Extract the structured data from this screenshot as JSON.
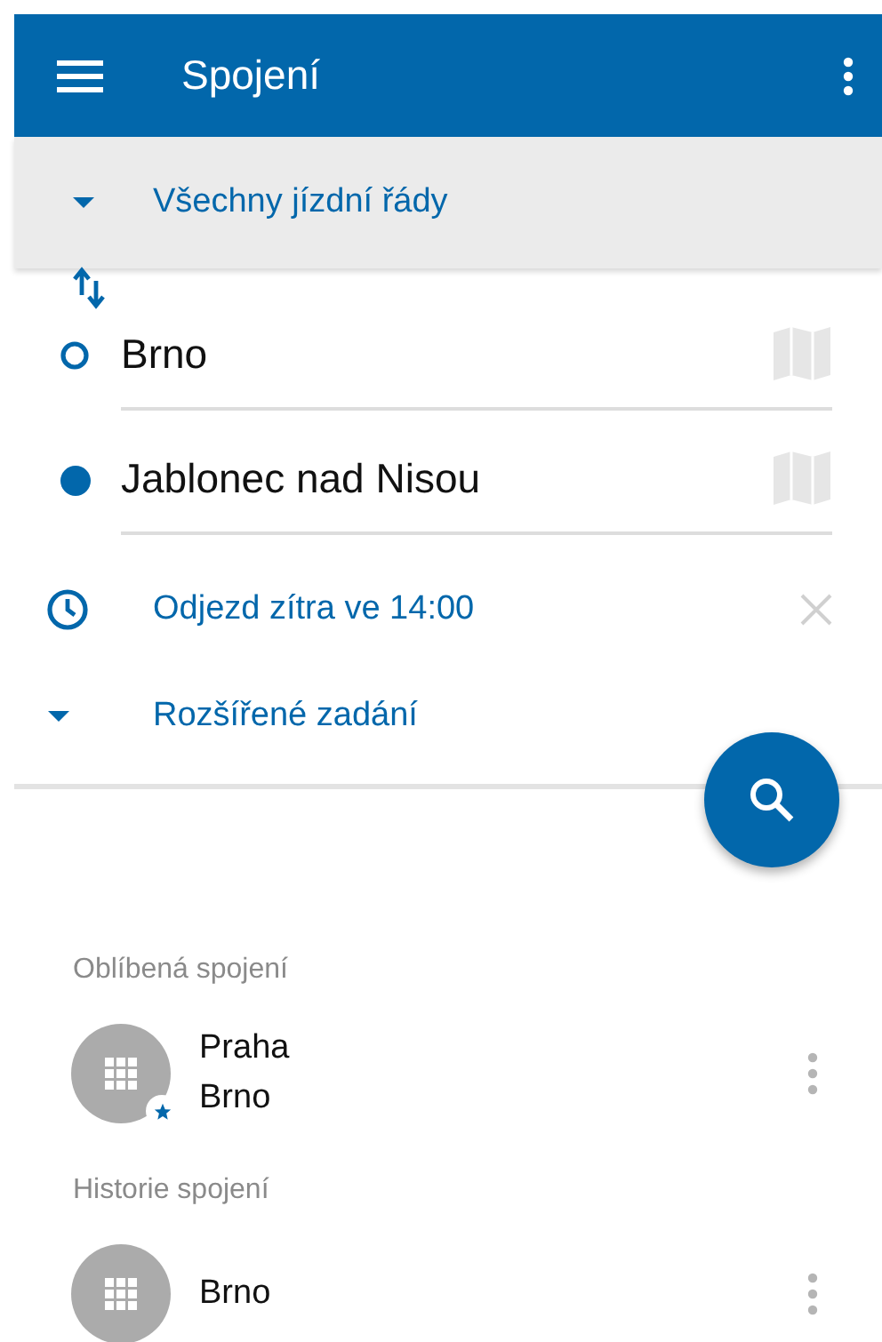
{
  "app_bar": {
    "title": "Spojení"
  },
  "filter": {
    "label": "Všechny jízdní řády",
    "expanded": false
  },
  "route": {
    "from": "Brno",
    "to": "Jablonec nad Nisou"
  },
  "departure": {
    "label": "Odjezd zítra ve 14:00"
  },
  "advanced": {
    "label": "Rozšířené zadání",
    "expanded": false
  },
  "sections": [
    {
      "title": "Oblíbená spojení",
      "items": [
        {
          "lines": [
            "Praha",
            "Brno"
          ],
          "favorite": true
        }
      ]
    },
    {
      "title": "Historie spojení",
      "items": [
        {
          "lines": [
            "Brno"
          ],
          "favorite": false
        }
      ]
    }
  ]
}
